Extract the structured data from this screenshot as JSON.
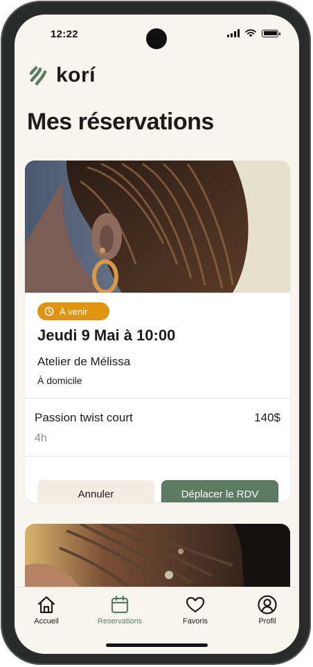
{
  "status_bar": {
    "time": "12:22"
  },
  "app": {
    "name": "korí"
  },
  "page": {
    "title": "Mes réservations"
  },
  "reservation": {
    "status": "À venir",
    "date": "Jeudi 9 Mai à 10:00",
    "salon": "Atelier de Mélissa",
    "location": "À domicile",
    "service": {
      "name": "Passion twist court",
      "price": "140$",
      "duration": "4h"
    },
    "actions": {
      "cancel": "Annuler",
      "reschedule": "Déplacer le RDV"
    }
  },
  "tabbar": {
    "items": [
      {
        "label": "Accueil",
        "icon": "home-icon"
      },
      {
        "label": "Reservations",
        "icon": "calendar-icon",
        "active": true
      },
      {
        "label": "Favoris",
        "icon": "heart-icon"
      },
      {
        "label": "Profil",
        "icon": "user-icon"
      }
    ]
  },
  "colors": {
    "accent": "#5b7b63",
    "badge": "#e0950f",
    "background": "#f8f4ee"
  }
}
